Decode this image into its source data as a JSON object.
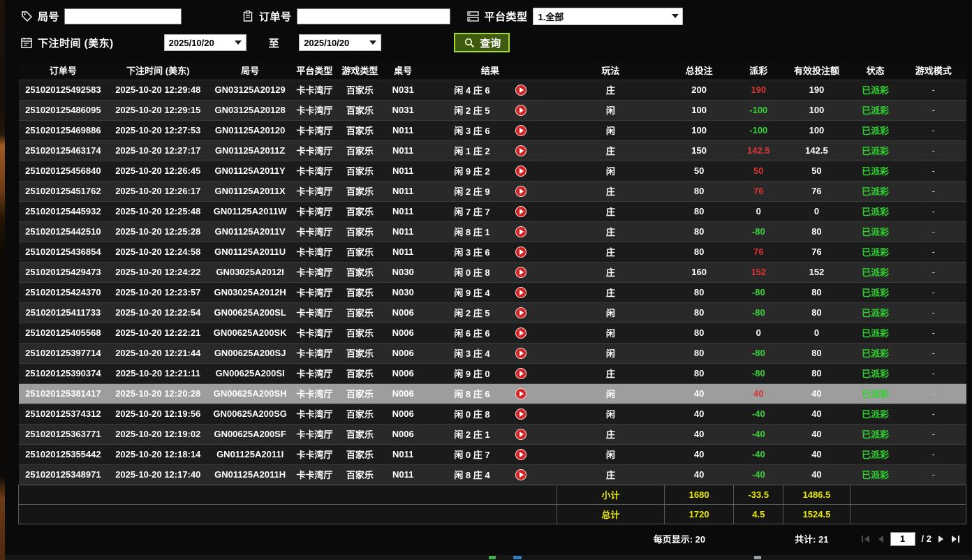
{
  "filters": {
    "round_label": "局号",
    "round_value": "",
    "order_label": "订单号",
    "order_value": "",
    "platform_label": "平台类型",
    "platform_selected": "1.全部",
    "bet_time_label": "下注时间 (美东)",
    "date_from": "2025/10/20",
    "to_label": "至",
    "date_to": "2025/10/20",
    "query_button": "查询"
  },
  "table": {
    "headers": [
      "订单号",
      "下注时间 (美东)",
      "局号",
      "平台类型",
      "游戏类型",
      "桌号",
      "结果",
      "玩法",
      "总投注",
      "派彩",
      "有效投注额",
      "状态",
      "游戏模式"
    ],
    "rows": [
      {
        "order_id": "251020125492583",
        "time": "2025-10-20 12:29:48",
        "round": "GN03125A20129",
        "platform": "卡卡湾厅",
        "game": "百家乐",
        "table_no": "N031",
        "result": "闲 4 庄 6",
        "play": "庄",
        "total_bet": "200",
        "payout": "190",
        "payout_color": "pos",
        "valid_bet": "190",
        "status": "已派彩",
        "mode": "-"
      },
      {
        "order_id": "251020125486095",
        "time": "2025-10-20 12:29:15",
        "round": "GN03125A20128",
        "platform": "卡卡湾厅",
        "game": "百家乐",
        "table_no": "N031",
        "result": "闲 2 庄 5",
        "play": "闲",
        "total_bet": "100",
        "payout": "-100",
        "payout_color": "neg",
        "valid_bet": "100",
        "status": "已派彩",
        "mode": "-"
      },
      {
        "order_id": "251020125469886",
        "time": "2025-10-20 12:27:53",
        "round": "GN01125A20120",
        "platform": "卡卡湾厅",
        "game": "百家乐",
        "table_no": "N011",
        "result": "闲 3 庄 6",
        "play": "闲",
        "total_bet": "100",
        "payout": "-100",
        "payout_color": "neg",
        "valid_bet": "100",
        "status": "已派彩",
        "mode": "-"
      },
      {
        "order_id": "251020125463174",
        "time": "2025-10-20 12:27:17",
        "round": "GN01125A2011Z",
        "platform": "卡卡湾厅",
        "game": "百家乐",
        "table_no": "N011",
        "result": "闲 1 庄 2",
        "play": "庄",
        "total_bet": "150",
        "payout": "142.5",
        "payout_color": "pos",
        "valid_bet": "142.5",
        "status": "已派彩",
        "mode": "-"
      },
      {
        "order_id": "251020125456840",
        "time": "2025-10-20 12:26:45",
        "round": "GN01125A2011Y",
        "platform": "卡卡湾厅",
        "game": "百家乐",
        "table_no": "N011",
        "result": "闲 9 庄 2",
        "play": "闲",
        "total_bet": "50",
        "payout": "50",
        "payout_color": "pos",
        "valid_bet": "50",
        "status": "已派彩",
        "mode": "-"
      },
      {
        "order_id": "251020125451762",
        "time": "2025-10-20 12:26:17",
        "round": "GN01125A2011X",
        "platform": "卡卡湾厅",
        "game": "百家乐",
        "table_no": "N011",
        "result": "闲 2 庄 9",
        "play": "庄",
        "total_bet": "80",
        "payout": "76",
        "payout_color": "pos",
        "valid_bet": "76",
        "status": "已派彩",
        "mode": "-"
      },
      {
        "order_id": "251020125445932",
        "time": "2025-10-20 12:25:48",
        "round": "GN01125A2011W",
        "platform": "卡卡湾厅",
        "game": "百家乐",
        "table_no": "N011",
        "result": "闲 7 庄 7",
        "play": "庄",
        "total_bet": "80",
        "payout": "0",
        "payout_color": "zero",
        "valid_bet": "0",
        "status": "已派彩",
        "mode": "-"
      },
      {
        "order_id": "251020125442510",
        "time": "2025-10-20 12:25:28",
        "round": "GN01125A2011V",
        "platform": "卡卡湾厅",
        "game": "百家乐",
        "table_no": "N011",
        "result": "闲 8 庄 1",
        "play": "庄",
        "total_bet": "80",
        "payout": "-80",
        "payout_color": "neg",
        "valid_bet": "80",
        "status": "已派彩",
        "mode": "-"
      },
      {
        "order_id": "251020125436854",
        "time": "2025-10-20 12:24:58",
        "round": "GN01125A2011U",
        "platform": "卡卡湾厅",
        "game": "百家乐",
        "table_no": "N011",
        "result": "闲 3 庄 6",
        "play": "庄",
        "total_bet": "80",
        "payout": "76",
        "payout_color": "pos",
        "valid_bet": "76",
        "status": "已派彩",
        "mode": "-"
      },
      {
        "order_id": "251020125429473",
        "time": "2025-10-20 12:24:22",
        "round": "GN03025A2012I",
        "platform": "卡卡湾厅",
        "game": "百家乐",
        "table_no": "N030",
        "result": "闲 0 庄 8",
        "play": "庄",
        "total_bet": "160",
        "payout": "152",
        "payout_color": "pos",
        "valid_bet": "152",
        "status": "已派彩",
        "mode": "-"
      },
      {
        "order_id": "251020125424370",
        "time": "2025-10-20 12:23:57",
        "round": "GN03025A2012H",
        "platform": "卡卡湾厅",
        "game": "百家乐",
        "table_no": "N030",
        "result": "闲 9 庄 4",
        "play": "庄",
        "total_bet": "80",
        "payout": "-80",
        "payout_color": "neg",
        "valid_bet": "80",
        "status": "已派彩",
        "mode": "-"
      },
      {
        "order_id": "251020125411733",
        "time": "2025-10-20 12:22:54",
        "round": "GN00625A200SL",
        "platform": "卡卡湾厅",
        "game": "百家乐",
        "table_no": "N006",
        "result": "闲 2 庄 5",
        "play": "闲",
        "total_bet": "80",
        "payout": "-80",
        "payout_color": "neg",
        "valid_bet": "80",
        "status": "已派彩",
        "mode": "-"
      },
      {
        "order_id": "251020125405568",
        "time": "2025-10-20 12:22:21",
        "round": "GN00625A200SK",
        "platform": "卡卡湾厅",
        "game": "百家乐",
        "table_no": "N006",
        "result": "闲 6 庄 6",
        "play": "闲",
        "total_bet": "80",
        "payout": "0",
        "payout_color": "zero",
        "valid_bet": "0",
        "status": "已派彩",
        "mode": "-"
      },
      {
        "order_id": "251020125397714",
        "time": "2025-10-20 12:21:44",
        "round": "GN00625A200SJ",
        "platform": "卡卡湾厅",
        "game": "百家乐",
        "table_no": "N006",
        "result": "闲 3 庄 4",
        "play": "闲",
        "total_bet": "80",
        "payout": "-80",
        "payout_color": "neg",
        "valid_bet": "80",
        "status": "已派彩",
        "mode": "-"
      },
      {
        "order_id": "251020125390374",
        "time": "2025-10-20 12:21:11",
        "round": "GN00625A200SI",
        "platform": "卡卡湾厅",
        "game": "百家乐",
        "table_no": "N006",
        "result": "闲 9 庄 0",
        "play": "庄",
        "total_bet": "80",
        "payout": "-80",
        "payout_color": "neg",
        "valid_bet": "80",
        "status": "已派彩",
        "mode": "-"
      },
      {
        "order_id": "251020125381417",
        "time": "2025-10-20 12:20:28",
        "round": "GN00625A200SH",
        "platform": "卡卡湾厅",
        "game": "百家乐",
        "table_no": "N006",
        "result": "闲 8 庄 6",
        "play": "闲",
        "total_bet": "40",
        "payout": "40",
        "payout_color": "pos",
        "valid_bet": "40",
        "status": "已派彩",
        "mode": "-",
        "selected": true
      },
      {
        "order_id": "251020125374312",
        "time": "2025-10-20 12:19:56",
        "round": "GN00625A200SG",
        "platform": "卡卡湾厅",
        "game": "百家乐",
        "table_no": "N006",
        "result": "闲 0 庄 8",
        "play": "闲",
        "total_bet": "40",
        "payout": "-40",
        "payout_color": "neg",
        "valid_bet": "40",
        "status": "已派彩",
        "mode": "-"
      },
      {
        "order_id": "251020125363771",
        "time": "2025-10-20 12:19:02",
        "round": "GN00625A200SF",
        "platform": "卡卡湾厅",
        "game": "百家乐",
        "table_no": "N006",
        "result": "闲 2 庄 1",
        "play": "庄",
        "total_bet": "40",
        "payout": "-40",
        "payout_color": "neg",
        "valid_bet": "40",
        "status": "已派彩",
        "mode": "-"
      },
      {
        "order_id": "251020125355442",
        "time": "2025-10-20 12:18:14",
        "round": "GN01125A2011I",
        "platform": "卡卡湾厅",
        "game": "百家乐",
        "table_no": "N011",
        "result": "闲 0 庄 7",
        "play": "闲",
        "total_bet": "40",
        "payout": "-40",
        "payout_color": "neg",
        "valid_bet": "40",
        "status": "已派彩",
        "mode": "-"
      },
      {
        "order_id": "251020125348971",
        "time": "2025-10-20 12:17:40",
        "round": "GN01125A2011H",
        "platform": "卡卡湾厅",
        "game": "百家乐",
        "table_no": "N011",
        "result": "闲 8 庄 4",
        "play": "庄",
        "total_bet": "40",
        "payout": "-40",
        "payout_color": "neg",
        "valid_bet": "40",
        "status": "已派彩",
        "mode": "-"
      }
    ],
    "subtotal": {
      "label": "小计",
      "total_bet": "1680",
      "payout": "-33.5",
      "valid_bet": "1486.5"
    },
    "grand_total": {
      "label": "总计",
      "total_bet": "1720",
      "payout": "4.5",
      "valid_bet": "1524.5"
    }
  },
  "footer": {
    "per_page": "每页显示: 20",
    "total_count": "共计: 21",
    "current_page": "1",
    "page_suffix": "/ 2"
  },
  "colors": {
    "win_red": "#d93535",
    "loss_green": "#38d338",
    "status_green": "#2fd32f",
    "summary_yellow": "#e9e900",
    "query_border_green": "#a7d92e"
  }
}
